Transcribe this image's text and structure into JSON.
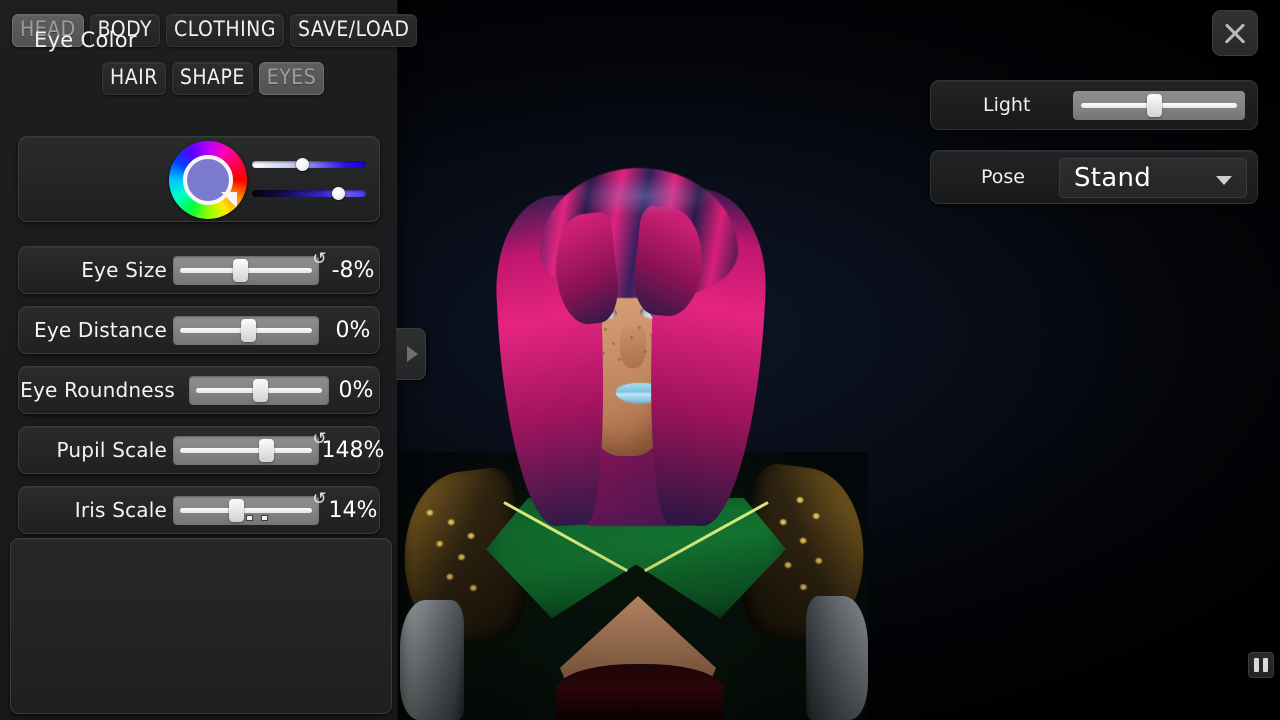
{
  "tabs": {
    "primary": [
      {
        "label": "HEAD",
        "active": true
      },
      {
        "label": "BODY",
        "active": false
      },
      {
        "label": "CLOTHING",
        "active": false
      },
      {
        "label": "SAVE/LOAD",
        "active": false
      }
    ],
    "secondary": [
      {
        "label": "HAIR",
        "active": false
      },
      {
        "label": "SHAPE",
        "active": false
      },
      {
        "label": "EYES",
        "active": true
      }
    ]
  },
  "eye_color": {
    "label": "Eye Color",
    "selected_hex": "#7b7bd0",
    "wheel_icon": "color-wheel-icon",
    "saturation_slider": {
      "name": "saturation",
      "position_pct": 39,
      "gradient_from": "#ffffff",
      "gradient_to": "#1605c8"
    },
    "value_slider": {
      "name": "brightness",
      "position_pct": 72,
      "gradient_from": "#050508",
      "gradient_to": "#4a3ae8"
    }
  },
  "sliders": [
    {
      "label": "Eye Size",
      "value": "-8%",
      "position_pct": 45,
      "has_reset": true,
      "reset_icon": "reset-icon",
      "drag_cursor": false
    },
    {
      "label": "Eye Distance",
      "value": "0%",
      "position_pct": 50,
      "has_reset": false,
      "reset_icon": "",
      "drag_cursor": false
    },
    {
      "label": "Eye Roundness",
      "value": "0%",
      "position_pct": 50,
      "has_reset": false,
      "reset_icon": "",
      "drag_cursor": false
    },
    {
      "label": "Pupil Scale",
      "value": "148%",
      "position_pct": 62,
      "has_reset": true,
      "reset_icon": "reset-icon",
      "drag_cursor": false
    },
    {
      "label": "Iris Scale",
      "value": "14%",
      "position_pct": 42,
      "has_reset": true,
      "reset_icon": "reset-icon",
      "drag_cursor": true
    }
  ],
  "right_panel": {
    "light": {
      "label": "Light",
      "position_pct": 45
    },
    "pose": {
      "label": "Pose",
      "value": "Stand",
      "chevron_icon": "chevron-down-icon"
    }
  },
  "buttons": {
    "close": {
      "icon": "close-icon",
      "label": ""
    },
    "pause": {
      "icon": "pause-icon",
      "label": ""
    },
    "collapse_panel": {
      "icon": "chevron-right-icon",
      "label": ""
    }
  },
  "reset_glyph": "↺",
  "character": {
    "hair_color": "#e52480",
    "hair_streak_color": "#2a1a48",
    "skin_color": "#d49b72",
    "eye_color": "#6e6ccd",
    "lip_color": "#7cc4e3",
    "armor_color": "#14872f",
    "armor_trim_color": "#d9ec7d",
    "pauldron_color": "#6a4f1c",
    "bodice_color": "#47080d"
  }
}
